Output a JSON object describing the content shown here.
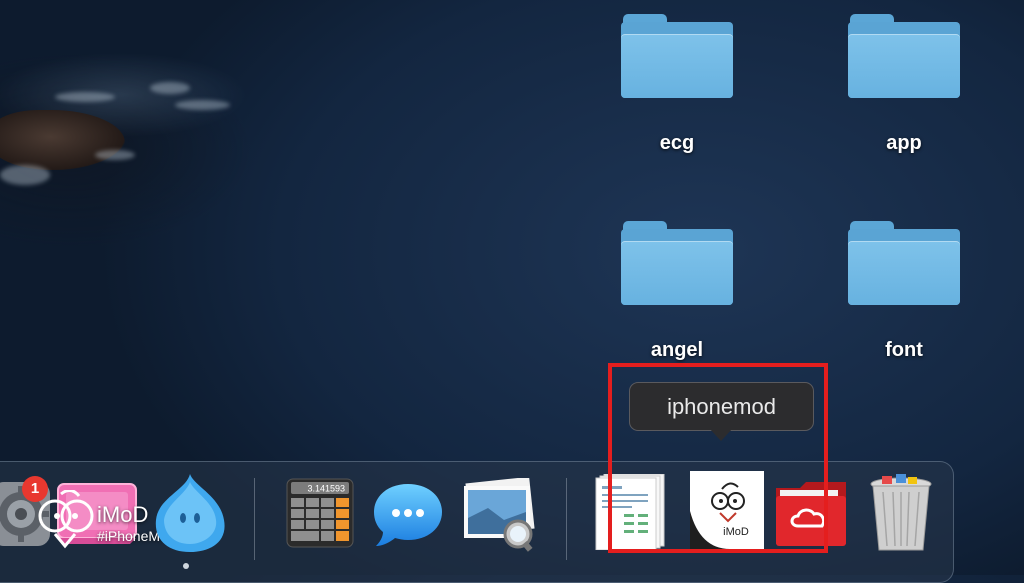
{
  "desktop": {
    "folders": [
      {
        "label": "ecg"
      },
      {
        "label": "app"
      },
      {
        "label": "angel"
      },
      {
        "label": "font"
      }
    ]
  },
  "tooltip": {
    "text": "iphonemod"
  },
  "calculator": {
    "display": "3.141593"
  },
  "badge": {
    "count": "1"
  },
  "watermark": {
    "title": "iMoD",
    "tag": "#iPhoneMod"
  },
  "stack_imod": {
    "label": "iMoD"
  },
  "dock": {
    "items": [
      {
        "name": "system-preferences-icon"
      },
      {
        "name": "pinkish-app-icon"
      },
      {
        "name": "chat-bubble-app-icon"
      },
      {
        "name": "calculator-icon"
      },
      {
        "name": "messages-icon"
      },
      {
        "name": "preview-icon"
      },
      {
        "name": "documents-stack-icon"
      },
      {
        "name": "iphonemod-stack-icon"
      },
      {
        "name": "creative-cloud-folder-icon"
      },
      {
        "name": "trash-icon"
      }
    ]
  },
  "colors": {
    "highlight": "#e41e1e",
    "folder": "#67b2e0",
    "badge": "#e8382f"
  }
}
